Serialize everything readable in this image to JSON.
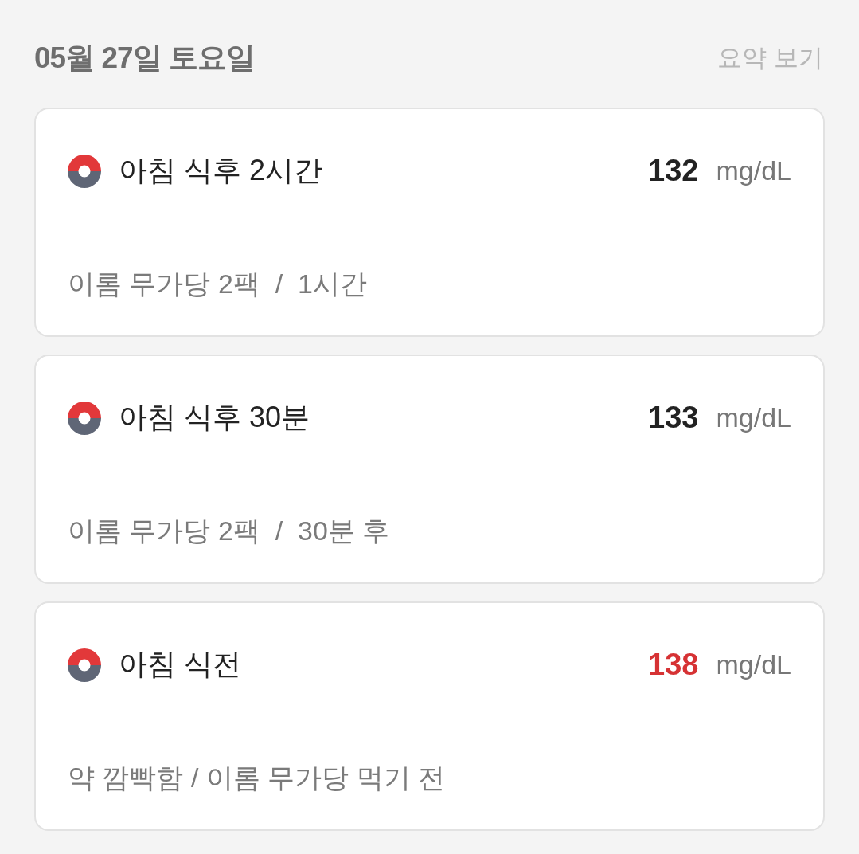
{
  "header": {
    "date": "05월 27일 토요일",
    "summary_link": "요약 보기"
  },
  "records": [
    {
      "title": "아침 식후 2시간",
      "value": "132",
      "unit": "mg/dL",
      "high": false,
      "note": "이롬 무가당 2팩  /  1시간"
    },
    {
      "title": "아침 식후 30분",
      "value": "133",
      "unit": "mg/dL",
      "high": false,
      "note": "이롬 무가당 2팩  /  30분 후"
    },
    {
      "title": "아침 식전",
      "value": "138",
      "unit": "mg/dL",
      "high": true,
      "note": "약 깜빡함 / 이롬 무가당 먹기 전"
    }
  ]
}
